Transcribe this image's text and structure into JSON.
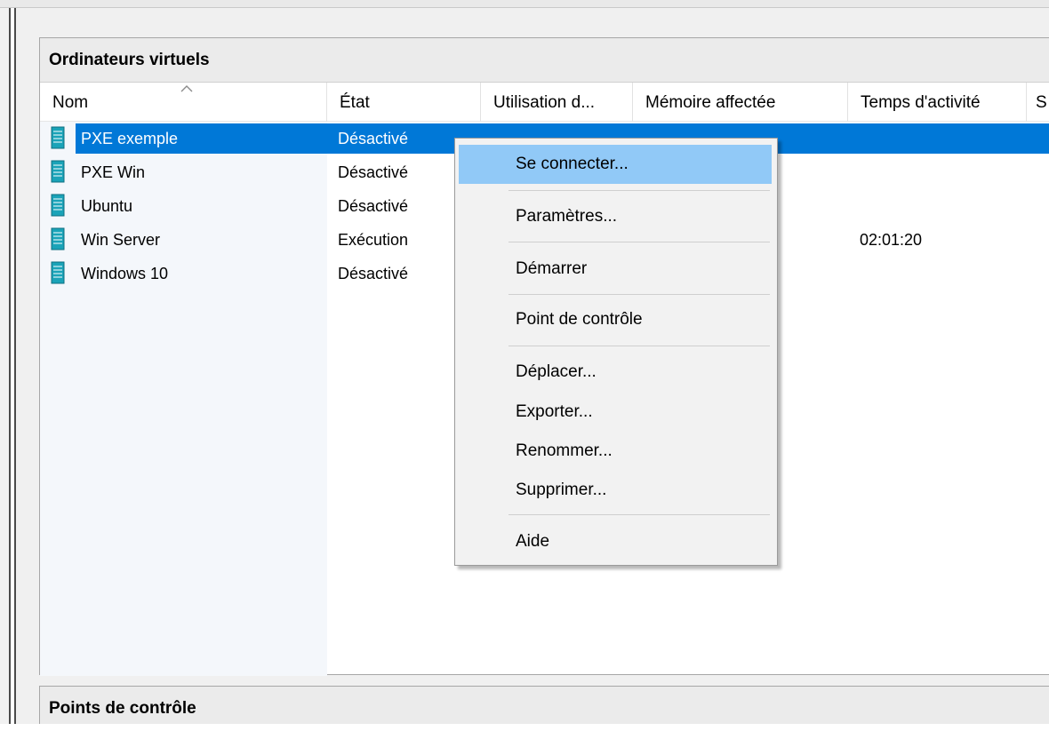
{
  "vm_panel": {
    "title": "Ordinateurs virtuels"
  },
  "columns": [
    {
      "label": "Nom"
    },
    {
      "label": "État"
    },
    {
      "label": "Utilisation d..."
    },
    {
      "label": "Mémoire affectée"
    },
    {
      "label": "Temps d'activité"
    },
    {
      "label": "S"
    }
  ],
  "vms": [
    {
      "name": "PXE exemple",
      "state": "Désactivé",
      "uptime": "",
      "selected": true
    },
    {
      "name": "PXE Win",
      "state": "Désactivé",
      "uptime": ""
    },
    {
      "name": "Ubuntu",
      "state": "Désactivé",
      "uptime": ""
    },
    {
      "name": "Win Server",
      "state": "Exécution",
      "uptime": "02:01:20"
    },
    {
      "name": "Windows 10",
      "state": "Désactivé",
      "uptime": ""
    }
  ],
  "context_menu": {
    "items": [
      {
        "label": "Se connecter...",
        "hover": true
      },
      {
        "label": "Paramètres..."
      },
      {
        "label": "Démarrer"
      },
      {
        "label": "Point de contrôle"
      },
      {
        "label": "Déplacer..."
      },
      {
        "label": "Exporter..."
      },
      {
        "label": "Renommer..."
      },
      {
        "label": "Supprimer..."
      },
      {
        "label": "Aide"
      }
    ]
  },
  "checkpoints_panel": {
    "title": "Points de contrôle"
  },
  "icons": {
    "vm": "vm-server-icon",
    "sort": "sort-ascending-icon"
  },
  "colors": {
    "selection": "#0078d7",
    "menu_hover": "#91c9f7",
    "icon_teal": "#1aa3b8"
  }
}
